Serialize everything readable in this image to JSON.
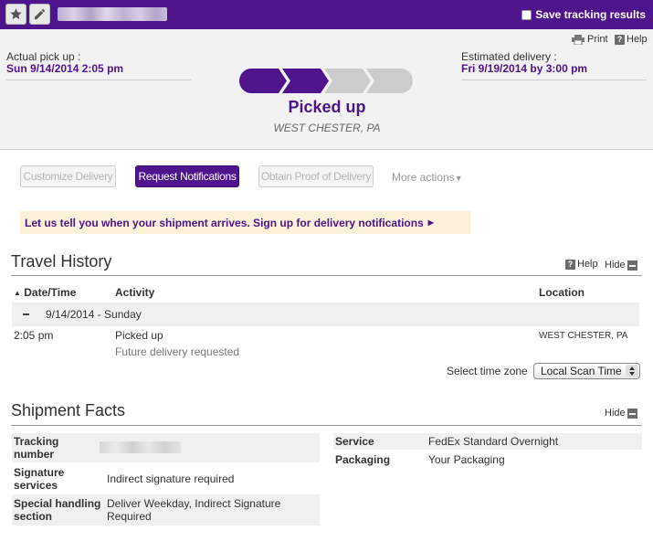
{
  "topbar": {
    "favorite_icon": "star-icon",
    "edit_icon": "pencil-icon",
    "save_label": "Save tracking results",
    "accent": "#4d148c"
  },
  "summary": {
    "pickup_label": "Actual pick up :",
    "pickup_value": "Sun 9/14/2014 2:05 pm",
    "estimated_label": "Estimated delivery :",
    "estimated_value": "Fri 9/19/2014 by 3:00 pm",
    "print_label": "Print",
    "help_label": "Help",
    "status_title": "Picked up",
    "status_location": "WEST CHESTER, PA",
    "progress_steps_total": 4,
    "progress_steps_complete": 2
  },
  "actions": {
    "customize": "Customize Delivery",
    "notifications": "Request Notifications",
    "proof": "Obtain Proof of Delivery",
    "more": "More actions"
  },
  "notify_banner": "Let us tell you when your shipment arrives. Sign up for delivery notifications",
  "travel_history": {
    "title": "Travel History",
    "help_label": "Help",
    "hide_label": "Hide",
    "columns": {
      "date": "Date/Time",
      "activity": "Activity",
      "location": "Location"
    },
    "date_group": "9/14/2014 - Sunday",
    "rows": [
      {
        "time": "2:05 pm",
        "activity": "Picked up",
        "detail": "Future delivery requested",
        "location": "WEST CHESTER, PA"
      }
    ],
    "timezone_label": "Select time zone",
    "timezone_value": "Local Scan Time"
  },
  "shipment_facts": {
    "title": "Shipment Facts",
    "hide_label": "Hide",
    "left": [
      {
        "label": "Tracking number",
        "value": ""
      },
      {
        "label": "Signature services",
        "value": "Indirect signature required"
      },
      {
        "label": "Special handling section",
        "value": "Deliver Weekday, Indirect Signature Required"
      }
    ],
    "right": [
      {
        "label": "Service",
        "value": "FedEx Standard Overnight"
      },
      {
        "label": "Packaging",
        "value": "Your Packaging"
      }
    ]
  }
}
